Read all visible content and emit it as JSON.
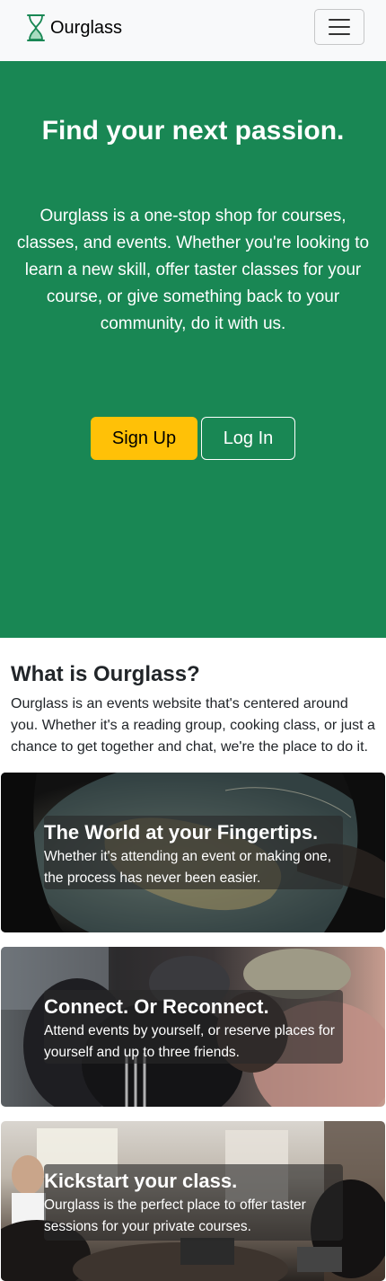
{
  "navbar": {
    "brand": "Ourglass",
    "logo_icon": "hourglass-icon",
    "menu_icon": "hamburger-icon"
  },
  "hero": {
    "title": "Find your next passion.",
    "text": "Ourglass is a one-stop shop for courses, classes, and events. Whether you're looking to learn a new skill, offer taster classes for your course, or give something back to your community, do it with us.",
    "signup_label": "Sign Up",
    "login_label": "Log In"
  },
  "about": {
    "title": "What is Ourglass?",
    "text": "Ourglass is an events website that's centered around you. Whether it's a reading group, cooking class, or just a chance to get together and chat, we're the place to do it."
  },
  "cards": [
    {
      "title": "The World at your Fingertips.",
      "text": "Whether it's attending an event or making one, the process has never been easier."
    },
    {
      "title": "Connect. Or Reconnect.",
      "text": "Attend events by yourself, or reserve places for yourself and up to three friends."
    },
    {
      "title": "Kickstart your class.",
      "text": "Ourglass is the perfect place to offer taster sessions for your private courses."
    }
  ],
  "colors": {
    "hero_green": "#198754",
    "signup_yellow": "#ffc107",
    "navbar_bg": "#f8f9fa"
  }
}
